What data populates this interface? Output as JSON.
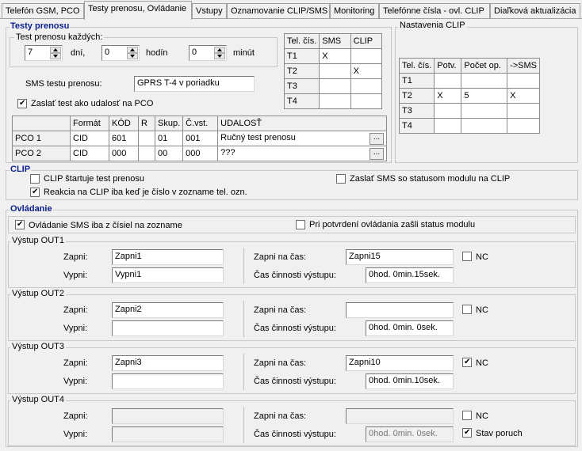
{
  "tabs": [
    {
      "label": "Telefón GSM, PCO"
    },
    {
      "label": "Testy prenosu, Ovládanie"
    },
    {
      "label": "Vstupy"
    },
    {
      "label": "Oznamovanie CLIP/SMS"
    },
    {
      "label": "Monitoring"
    },
    {
      "label": "Telefónne čísla - ovl. CLIP"
    },
    {
      "label": "Diaľková aktualizácia"
    }
  ],
  "testy": {
    "title": "Testy prenosu",
    "interval_group": "Test prenosu každých:",
    "days_value": "7",
    "days_label": "dní,",
    "hours_value": "0",
    "hours_label": "hodín",
    "minutes_value": "0",
    "minutes_label": "minút",
    "sms_label": "SMS testu prenosu:",
    "sms_value": "GPRS T-4 v poriadku",
    "send_event_label": "Zaslať test ako udalosť na PCO",
    "send_event_checked": true,
    "tel_table": {
      "headers": [
        "Tel. čís.",
        "SMS",
        "CLIP"
      ],
      "rows": [
        [
          "T1",
          "X",
          ""
        ],
        [
          "T2",
          "",
          "X"
        ],
        [
          "T3",
          "",
          ""
        ],
        [
          "T4",
          "",
          ""
        ]
      ]
    },
    "pco_table": {
      "headers": [
        "",
        "Formát",
        "KÓD",
        "R",
        "Skup.",
        "Č.vst.",
        "UDALOSŤ"
      ],
      "rows": [
        [
          "PCO 1",
          "CID",
          "601",
          "",
          "01",
          "001",
          "Ručný test prenosu"
        ],
        [
          "PCO 2",
          "CID",
          "000",
          "",
          "00",
          "000",
          "???"
        ]
      ],
      "dots": "..."
    }
  },
  "nastavenia_clip": {
    "title": "Nastavenia CLIP",
    "headers": [
      "Tel. čís.",
      "Potv.",
      "Počet op.",
      "->SMS"
    ],
    "rows": [
      [
        "T1",
        "",
        "",
        ""
      ],
      [
        "T2",
        "X",
        "5",
        "X"
      ],
      [
        "T3",
        "",
        "",
        ""
      ],
      [
        "T4",
        "",
        "",
        ""
      ]
    ]
  },
  "clip": {
    "title": "CLIP",
    "start_test_label": "CLIP štartuje test prenosu",
    "start_test_checked": false,
    "react_label": "Reakcia na CLIP iba keď je číslo v zozname tel. ozn.",
    "react_checked": true,
    "send_sms_label": "Zaslať SMS so statusom modulu na CLIP",
    "send_sms_checked": false
  },
  "ovladanie": {
    "title": "Ovládanie",
    "sms_only_label": "Ovládanie SMS iba z čísiel na zozname",
    "sms_only_checked": true,
    "confirm_label": "Pri potvrdení ovládania zašli status modulu",
    "confirm_checked": false,
    "on_label": "Zapni:",
    "off_label": "Vypni:",
    "on_time_label": "Zapni na čas:",
    "duration_label": "Čas činnosti výstupu:",
    "nc_label": "NC",
    "fault_label": "Stav poruch",
    "outputs": [
      {
        "title": "Výstup OUT1",
        "on": "Zapni1",
        "off": "Vypni1",
        "on_time": "Zapni15",
        "duration": "0hod. 0min.15sek.",
        "nc": false,
        "disabled": false
      },
      {
        "title": "Výstup OUT2",
        "on": "Zapni2",
        "off": "",
        "on_time": "",
        "duration": "0hod. 0min. 0sek.",
        "nc": false,
        "disabled": false
      },
      {
        "title": "Výstup OUT3",
        "on": "Zapni3",
        "off": "",
        "on_time": "Zapni10",
        "duration": "0hod. 0min.10sek.",
        "nc": true,
        "disabled": false
      },
      {
        "title": "Výstup OUT4",
        "on": "",
        "off": "",
        "on_time": "",
        "duration": "0hod. 0min. 0sek.",
        "nc": false,
        "disabled": true,
        "fault_checked": true
      }
    ]
  }
}
